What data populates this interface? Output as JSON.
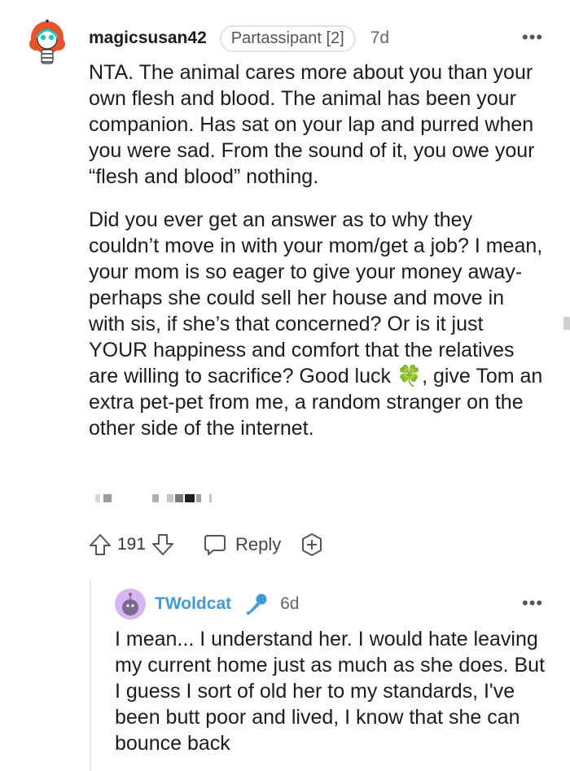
{
  "comment": {
    "username": "magicsusan42",
    "flair": "Partassipant [2]",
    "age": "7d",
    "more_icon": "more-dots-icon",
    "paragraph1": "NTA. The animal cares more about you than your own flesh and blood. The animal has been your companion. Has sat on your lap and purred when you were sad. From the sound of it, you owe your “flesh and blood” nothing.",
    "paragraph2": "Did you ever get an answer as to why they couldn’t move in with your mom/get a job? I mean, your mom is so eager to give your money away- perhaps she could sell her house and move in with sis, if she’s that concerned? Or is it just YOUR happiness and comfort that the relatives are willing to sacrifice? Good luck 🍀, give Tom an extra pet-pet from me, a random stranger on the other side of the internet.",
    "votes": "191",
    "reply_label": "Reply"
  },
  "reply": {
    "username": "TWoldcat",
    "age": "6d",
    "badge_icon": "microphone-icon",
    "text": "I mean... I understand her. I would hate leaving my current home just as much as she does. But I guess I sort of old her to my standards, I've been butt poor and lived, I know that she can bounce back"
  },
  "colors": {
    "link_blue": "#3e9bd9",
    "text": "#1c1c1c",
    "meta": "#666666"
  }
}
